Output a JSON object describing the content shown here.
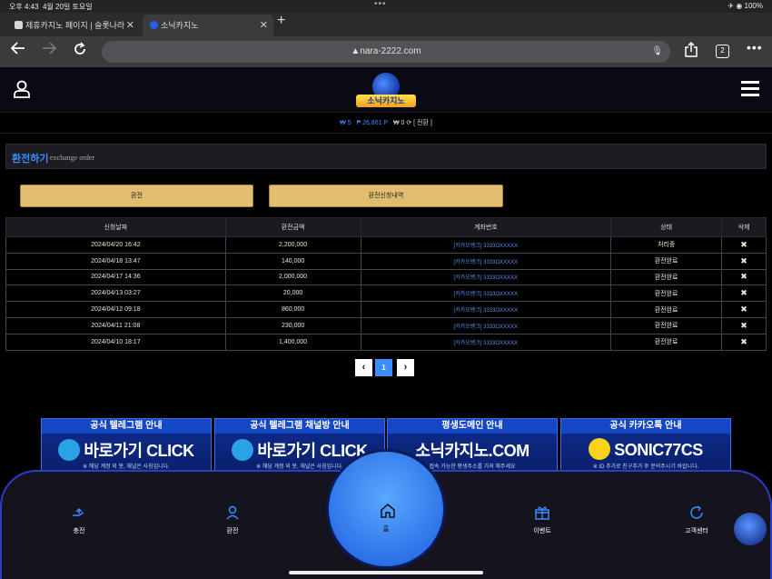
{
  "status": {
    "time": "오후 4:43",
    "date": "4월 20일 토요일",
    "dots": "•••",
    "right": "✈ ◉ 100%"
  },
  "browser": {
    "tabs": [
      {
        "label": "제휴카지노 페이지 | 슬롯나라"
      },
      {
        "label": "소닉카지노"
      }
    ],
    "url": "nara-2222.com",
    "tab_count": "2"
  },
  "site": {
    "logo_text": "소닉카지노"
  },
  "balance": {
    "won": "₩ 5",
    "point": "₱ 26,861 P",
    "b": "₩ 0",
    "convert": "[ 전환 ]"
  },
  "section": {
    "title": "환전하기",
    "subtitle": "exchange order"
  },
  "buttons": {
    "exchange": "환전",
    "history": "환전신청내역"
  },
  "table": {
    "headers": [
      "신청날짜",
      "환전금액",
      "계좌번호",
      "상태",
      "삭제"
    ],
    "rows": [
      {
        "date": "2024/04/20 16:42",
        "amount": "2,200,000",
        "account": "[카카오뱅크] 3333OXXXXX",
        "status": "처리중",
        "del": "✖"
      },
      {
        "date": "2024/04/18 13:47",
        "amount": "140,000",
        "account": "[카카오뱅크] 3333OXXXXX",
        "status": "환전완료",
        "del": "✖"
      },
      {
        "date": "2024/04/17 14:36",
        "amount": "2,000,000",
        "account": "[카카오뱅크] 3333OXXXXX",
        "status": "환전완료",
        "del": "✖"
      },
      {
        "date": "2024/04/13 03:27",
        "amount": "20,000",
        "account": "[카카오뱅크] 3333OXXXXX",
        "status": "환전완료",
        "del": "✖"
      },
      {
        "date": "2024/04/12 09:18",
        "amount": "860,000",
        "account": "[카카오뱅크] 3333OXXXXX",
        "status": "환전완료",
        "del": "✖"
      },
      {
        "date": "2024/04/11 21:08",
        "amount": "230,000",
        "account": "[카카오뱅크] 3333OXXXXX",
        "status": "환전완료",
        "del": "✖"
      },
      {
        "date": "2024/04/10 18:17",
        "amount": "1,400,000",
        "account": "[카카오뱅크] 3333OXXXXX",
        "status": "환전완료",
        "del": "✖"
      }
    ]
  },
  "pager": {
    "prev": "‹",
    "current": "1",
    "next": "›"
  },
  "banners": [
    {
      "head": "공식 텔레그램 안내",
      "main": "바로가기 CLICK",
      "note": "※ 해당 계정 외 봇, 채널은 사칭입니다."
    },
    {
      "head": "공식 텔레그램 채널방 안내",
      "main": "바로가기 CLICK",
      "note": "※ 해당 계정 외 봇, 채널은 사칭입니다."
    },
    {
      "head": "평생도메인 안내",
      "main": "소닉카지노.COM",
      "note": "접속 가능한 평생주소를 가져 해주세요"
    },
    {
      "head": "공식 카카오톡 안내",
      "main": "SONIC77CS",
      "note": "※ ID 추가로 친구추가 후 문의주시기 바랍니다."
    }
  ],
  "bottomnav": {
    "deposit": "충전",
    "withdraw": "환전",
    "home": "홈",
    "event": "이벤트",
    "support": "고객센터"
  },
  "colors": {
    "accent": "#3a8dff",
    "button_gold": "#e2bd6f",
    "banner_blue": "#0d2d92"
  }
}
